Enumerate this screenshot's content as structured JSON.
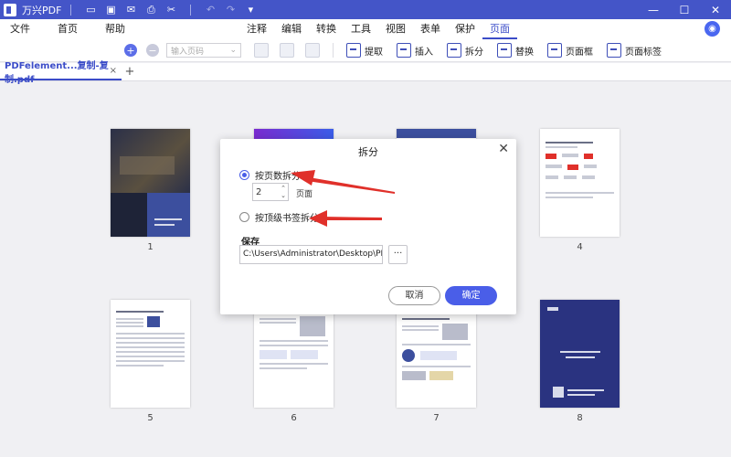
{
  "app": {
    "name": "万兴PDF"
  },
  "quick_icons": [
    "folder-icon",
    "save-icon",
    "mail-icon",
    "print-icon",
    "scissors-icon",
    "undo-icon",
    "redo-icon",
    "dropdown-icon"
  ],
  "window": {
    "minimize": "—",
    "maximize": "☐",
    "close": "✕"
  },
  "menu": {
    "left": [
      "文件",
      "首页",
      "帮助"
    ],
    "center": [
      "注释",
      "编辑",
      "转换",
      "工具",
      "视图",
      "表单",
      "保护",
      "页面"
    ],
    "active": "页面"
  },
  "toolbar": {
    "page_placeholder": "输入页码",
    "tools": [
      "提取",
      "插入",
      "拆分",
      "替换",
      "页面框",
      "页面标签"
    ]
  },
  "tab": {
    "title": "PDFelement...复制-复制.pdf",
    "close": "×",
    "add": "+"
  },
  "thumbnails": [
    {
      "label": "1"
    },
    {
      "label": "4"
    },
    {
      "label": "5"
    },
    {
      "label": "6"
    },
    {
      "label": "7"
    },
    {
      "label": "8"
    }
  ],
  "dialog": {
    "title": "拆分",
    "close": "✕",
    "option_pages": "按页数拆分",
    "pages_value": "2",
    "pages_unit": "页面",
    "option_bookmark": "按顶级书签拆分",
    "save_label": "保存",
    "save_path": "C:\\Users\\Administrator\\Desktop\\PDFExp",
    "browse": "···",
    "cancel": "取消",
    "ok": "确定"
  },
  "colors": {
    "accent": "#4455c8",
    "primary_button": "#4a5ee8",
    "annotation": "#e0302a"
  }
}
